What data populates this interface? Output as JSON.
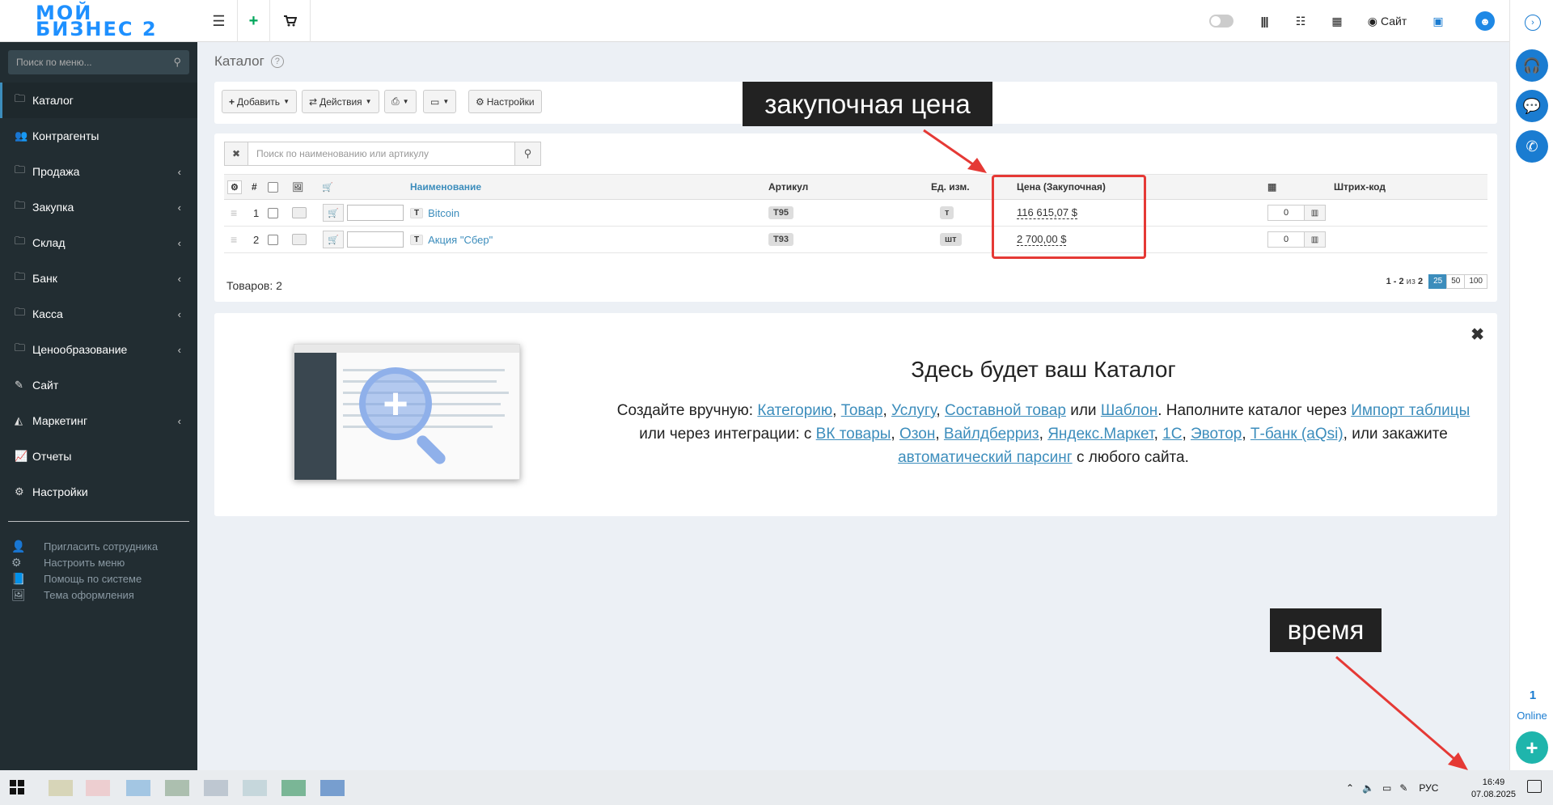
{
  "logo": {
    "line1": "МОЙ",
    "line2": "БИЗНЕС 2"
  },
  "topbar": {
    "site_label": "Сайт"
  },
  "sidebar": {
    "search_placeholder": "Поиск по меню...",
    "items": [
      {
        "label": "Каталог",
        "icon": "folder-icon",
        "active": true,
        "has_sub": false
      },
      {
        "label": "Контрагенты",
        "icon": "users-icon",
        "has_sub": false
      },
      {
        "label": "Продажа",
        "icon": "folder-icon",
        "has_sub": true
      },
      {
        "label": "Закупка",
        "icon": "folder-icon",
        "has_sub": true
      },
      {
        "label": "Склад",
        "icon": "folder-icon",
        "has_sub": true
      },
      {
        "label": "Банк",
        "icon": "folder-icon",
        "has_sub": true
      },
      {
        "label": "Касса",
        "icon": "folder-icon",
        "has_sub": true
      },
      {
        "label": "Ценообразование",
        "icon": "folder-icon",
        "has_sub": true
      },
      {
        "label": "Сайт",
        "icon": "magic-icon",
        "has_sub": false
      },
      {
        "label": "Маркетинг",
        "icon": "area-chart-icon",
        "has_sub": true
      },
      {
        "label": "Отчеты",
        "icon": "line-chart-icon",
        "has_sub": false
      },
      {
        "label": "Настройки",
        "icon": "gear-icon",
        "has_sub": false
      }
    ],
    "links": [
      {
        "label": "Пригласить сотрудника",
        "icon": "user-plus-icon"
      },
      {
        "label": "Настроить меню",
        "icon": "gears-icon"
      },
      {
        "label": "Помощь по системе",
        "icon": "book-icon"
      },
      {
        "label": "Тема оформления",
        "icon": "image-icon"
      }
    ]
  },
  "page": {
    "title": "Каталог",
    "toolbar": {
      "add": "Добавить",
      "actions": "Действия",
      "settings": "Настройки"
    },
    "search_placeholder": "Поиск по наименованию или артикулу",
    "columns": {
      "num": "#",
      "name": "Наименование",
      "article": "Артикул",
      "unit": "Ед. изм.",
      "price": "Цена (Закупочная)",
      "barcode": "Штрих-код"
    },
    "rows": [
      {
        "num": "1",
        "type": "Т",
        "name": "Bitcoin",
        "article": "Т95",
        "unit": "т",
        "price": "116 615,07 $",
        "stock": "0"
      },
      {
        "num": "2",
        "type": "Т",
        "name": "Акция \"Сбер\"",
        "article": "Т93",
        "unit": "шт",
        "price": "2 700,00 $",
        "stock": "0"
      }
    ],
    "goods_count": "Товаров: 2",
    "pager": {
      "range": "1 - 2",
      "of": "из",
      "total": "2",
      "sizes": [
        "25",
        "50",
        "100"
      ],
      "active_size": "25"
    }
  },
  "empty": {
    "title": "Здесь будет ваш Каталог",
    "t1": "Создайте вручную: ",
    "l_category": "Категорию",
    "l_product": "Товар",
    "l_service": "Услугу",
    "l_composite": "Составной товар",
    "t_or": " или ",
    "l_template": "Шаблон",
    "t2": ". Наполните каталог через ",
    "l_import": "Импорт таблицы",
    "t3": " или через интеграции: с ",
    "l_vk": "ВК товары",
    "l_ozon": "Озон",
    "l_wb": "Вайлдберриз",
    "l_ym": "Яндекс.Маркет",
    "l_1c": "1С",
    "l_evotor": "Эвотор",
    "l_tbank": "Т-банк (aQsi)",
    "t4": ", или закажите ",
    "l_parsing": "автоматический парсинг",
    "t5": " с любого сайта.",
    "sep": ", "
  },
  "annotations": {
    "price_label": "закупочная цена",
    "time_label": "время"
  },
  "rail": {
    "online_count": "1",
    "online_label": "Online"
  },
  "taskbar": {
    "lang": "РУС",
    "time": "16:49",
    "date": "07.08.2025"
  },
  "colors": {
    "accent": "#3c8dbc",
    "sidebar": "#222d32",
    "annotation": "#e53935"
  }
}
